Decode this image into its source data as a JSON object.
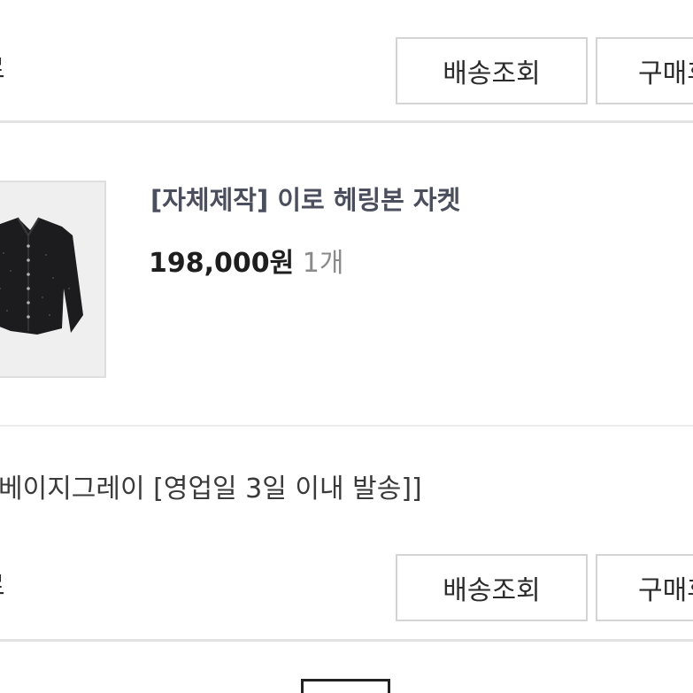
{
  "order_block_1": {
    "status_fragment": "로",
    "track_button": "배송조회",
    "review_button": "구매후기"
  },
  "product": {
    "name": "[자체제작] 이로 헤링본 자켓",
    "price": "198,000원",
    "quantity": "1개",
    "image_icon": "jacket-icon"
  },
  "option": {
    "text": "베이지그레이 [영업일 3일 이내 발송]]"
  },
  "order_block_2": {
    "status_fragment": "로",
    "track_button": "배송조회",
    "review_button": "구매후기"
  },
  "colors": {
    "border": "#d4d4d4",
    "divider": "#e2e2e2",
    "title": "#4b4e5c",
    "qty": "#8a8a8a"
  }
}
